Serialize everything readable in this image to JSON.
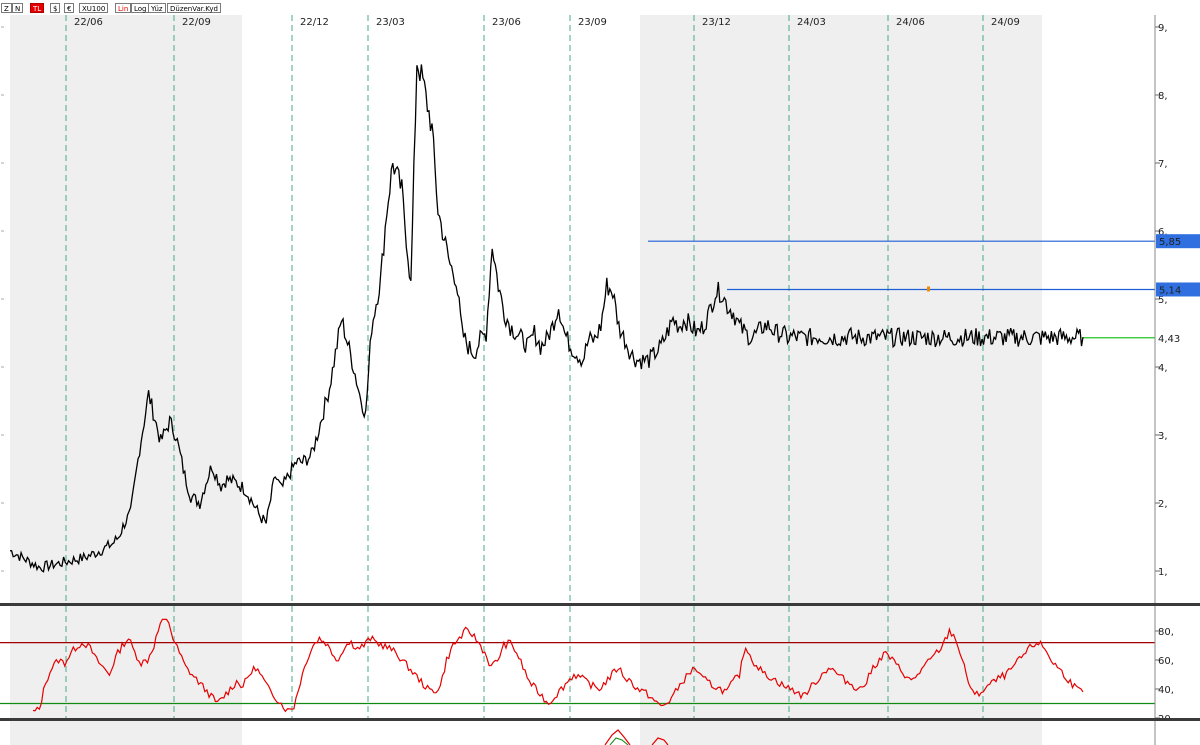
{
  "toolbar": {
    "buttons": [
      "Z",
      "N",
      "TL",
      "$",
      "€",
      "XU100",
      "Lin",
      "Log",
      "Yüz",
      "DüzenVar.Kyd"
    ]
  },
  "colors": {
    "price_line": "#000000",
    "rsi_line": "#e60000",
    "resistance_line": "#1f5fd6",
    "last_price_line": "#22c422",
    "rsi_upper_band": "#a00000",
    "rsi_lower_band": "#118a11",
    "shaded_band": "#efefef",
    "grid_dash": "#4aa88a",
    "label_bg": "#2f6fe0"
  },
  "chart_data": [
    {
      "type": "line",
      "panel": "price",
      "x_ticks": [
        "22/06",
        "22/09",
        "22/12",
        "23/03",
        "23/06",
        "23/09",
        "23/12",
        "24/03",
        "24/06",
        "24/09"
      ],
      "y_ticks": [
        "9,",
        "8,",
        "7,",
        "6,",
        "5,",
        "4,",
        "3,",
        "2,",
        "1,"
      ],
      "ylim": [
        0.95,
        9.1
      ],
      "grid": "vertical dashed",
      "series": [
        {
          "x": [
            0,
            1,
            1.5,
            2,
            2.5,
            3,
            3.4,
            3.6,
            3.8,
            4,
            4.3,
            4.6,
            5,
            5.3,
            5.5,
            5.8,
            6,
            6.3,
            6.5,
            6.7,
            7,
            7.2,
            7.5,
            7.8,
            8,
            8.3,
            8.5,
            8.8,
            9,
            9.3,
            9.5,
            9.7,
            10,
            10.2,
            10.4,
            10.6,
            10.8,
            11,
            11.2,
            11.4,
            11.6,
            11.8,
            12,
            12.3,
            12.5,
            12.7,
            13,
            13.3,
            13.5,
            13.7,
            14,
            14.2,
            14.4,
            14.6,
            14.8,
            15,
            15.2,
            15.4,
            15.6,
            15.8,
            16,
            16.2,
            16.4,
            16.6,
            16.8,
            17,
            17.2,
            17.4,
            17.6,
            17.8,
            18,
            18.2,
            18.4,
            18.6,
            18.8,
            19,
            19.2,
            19.4,
            19.6,
            19.8,
            20,
            20.2,
            20.4,
            20.6,
            20.8,
            21,
            21.2,
            21.4,
            21.6,
            21.8,
            22,
            22.2,
            22.4,
            22.6,
            22.8,
            23,
            23.2,
            23.4,
            23.6,
            23.8,
            24,
            24.2,
            24.4,
            24.6,
            24.8,
            25,
            25.2,
            25.4,
            25.6,
            25.8,
            26,
            26.2,
            26.4,
            26.6,
            26.8,
            27,
            27.2,
            27.4,
            27.6,
            27.8,
            28,
            28.2,
            28.4,
            28.6,
            28.8,
            29,
            29.2,
            29.4,
            29.6,
            29.8,
            30,
            30.2,
            30.4,
            30.6,
            30.8,
            31,
            31.2,
            31.4,
            31.6,
            31.8,
            32,
            32.2,
            32.4,
            32.6,
            32.8,
            33,
            33.2,
            33.4,
            33.6,
            33.8,
            34,
            34.2,
            34.4,
            34.6,
            34.8,
            35,
            35.2,
            35.4,
            35.6
          ],
          "y": [
            1.3,
            1.05,
            1.1,
            1.15,
            1.2,
            1.3,
            1.4,
            1.5,
            1.7,
            1.85,
            2.8,
            3.6,
            2.9,
            3.2,
            3.0,
            2.4,
            2.1,
            2.0,
            2.3,
            2.55,
            2.25,
            2.35,
            2.3,
            2.2,
            2.05,
            1.8,
            1.7,
            2.4,
            2.2,
            2.45,
            2.6,
            2.6,
            2.7,
            3.0,
            3.35,
            3.7,
            4.2,
            4.7,
            4.35,
            4.0,
            3.6,
            3.3,
            4.6,
            5.3,
            6.3,
            7.0,
            6.6,
            5.2,
            8.5,
            8.2,
            7.5,
            6.3,
            5.9,
            5.5,
            5.3,
            4.5,
            4.3,
            4.2,
            4.4,
            4.5,
            5.8,
            5.2,
            4.8,
            4.6,
            4.5,
            4.4,
            4.3,
            4.5,
            4.3,
            4.4,
            4.6,
            4.9,
            4.5,
            4.3,
            4.2,
            4.1,
            4.4,
            4.4,
            4.6,
            5.2,
            5.1,
            4.6,
            4.4,
            4.2,
            4.1,
            4.1,
            4.1,
            4.2,
            4.3,
            4.5,
            4.7,
            4.6,
            4.7,
            4.6,
            4.5,
            4.6,
            4.8,
            5.1,
            5.1,
            4.9,
            4.8,
            4.6,
            4.5,
            4.43,
            4.5,
            4.6,
            4.6,
            4.5,
            4.5,
            4.43,
            4.45,
            4.43,
            4.44,
            4.43,
            4.45,
            4.44,
            4.43,
            4.44,
            4.43,
            4.45,
            4.44,
            4.43,
            4.44,
            4.43,
            4.44,
            4.43,
            4.44,
            4.43,
            4.44,
            4.43,
            4.44,
            4.43,
            4.44,
            4.43,
            4.44,
            4.43,
            4.44,
            4.43,
            4.44,
            4.43,
            4.44,
            4.43,
            4.44,
            4.43,
            4.44,
            4.43,
            4.44,
            4.43,
            4.44,
            4.43,
            4.44,
            4.43,
            4.44,
            4.43,
            4.44,
            4.43,
            4.44,
            4.43,
            4.44
          ]
        }
      ],
      "levels": [
        {
          "value": 5.85,
          "label": "5,85",
          "kind": "resistance"
        },
        {
          "value": 5.14,
          "label": "5,14",
          "kind": "resistance"
        },
        {
          "value": 4.43,
          "label": "4,43",
          "kind": "last"
        }
      ]
    },
    {
      "type": "line",
      "panel": "rsi",
      "y_ticks": [
        "80,",
        "60,",
        "40,",
        "20"
      ],
      "ylim": [
        20,
        90
      ],
      "bands": [
        72,
        30
      ],
      "series": [
        {
          "values": [
            24,
            26,
            45,
            55,
            60,
            58,
            65,
            70,
            72,
            68,
            60,
            55,
            50,
            62,
            70,
            75,
            65,
            58,
            60,
            70,
            85,
            92,
            75,
            65,
            55,
            50,
            45,
            40,
            35,
            30,
            35,
            40,
            45,
            42,
            50,
            55,
            48,
            40,
            35,
            30,
            25,
            28,
            45,
            60,
            70,
            75,
            72,
            65,
            60,
            70,
            72,
            68,
            70,
            75,
            72,
            70,
            68,
            65,
            60,
            55,
            50,
            45,
            40,
            38,
            42,
            60,
            70,
            75,
            80,
            78,
            72,
            65,
            55,
            60,
            70,
            72,
            65,
            55,
            45,
            40,
            35,
            30,
            35,
            40,
            45,
            50,
            48,
            45,
            42,
            40,
            45,
            50,
            55,
            48,
            45,
            40,
            38,
            35,
            30,
            28,
            32,
            38,
            45,
            50,
            55,
            48,
            45,
            42,
            40,
            38,
            45,
            50,
            70,
            60,
            55,
            50,
            48,
            45,
            42,
            40,
            38,
            35,
            40,
            45,
            50,
            55,
            52,
            48,
            45,
            42,
            40,
            45,
            55,
            60,
            65,
            60,
            55,
            50,
            45,
            50,
            55,
            60,
            65,
            70,
            80,
            75,
            60,
            45,
            35,
            38,
            42,
            45,
            48,
            50,
            55,
            60,
            65,
            70,
            72,
            68,
            60,
            55,
            50,
            45,
            40,
            38
          ]
        }
      ]
    }
  ]
}
